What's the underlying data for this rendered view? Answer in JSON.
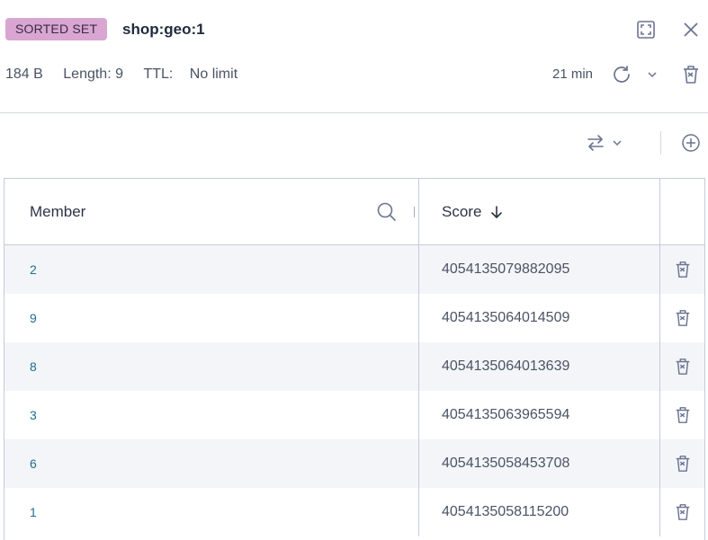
{
  "header": {
    "type_badge": "SORTED SET",
    "key_name": "shop:geo:1",
    "size": "184 B",
    "length": "Length: 9",
    "ttl_label": "TTL:",
    "ttl_value": "No limit",
    "refresh_time": "21 min"
  },
  "table": {
    "columns": [
      "Member",
      "Score"
    ],
    "rows": [
      {
        "member": "2",
        "score": "4054135079882095"
      },
      {
        "member": "9",
        "score": "4054135064014509"
      },
      {
        "member": "8",
        "score": "4054135064013639"
      },
      {
        "member": "3",
        "score": "4054135063965594"
      },
      {
        "member": "6",
        "score": "4054135058453708"
      },
      {
        "member": "1",
        "score": "4054135058115200"
      }
    ]
  },
  "icons": {
    "fullscreen": "fullscreen-icon",
    "close": "close-icon",
    "refresh": "refresh-icon",
    "delete": "trash-icon",
    "swap": "swap-arrows-icon",
    "add": "plus-circle-icon",
    "search": "search-icon",
    "sort": "arrow-down-icon"
  },
  "colors": {
    "badge_bg": "#d8a6d1",
    "member_text": "#1e6f8f",
    "icon": "#6b7490",
    "row_alt": "#f4f5f8"
  }
}
